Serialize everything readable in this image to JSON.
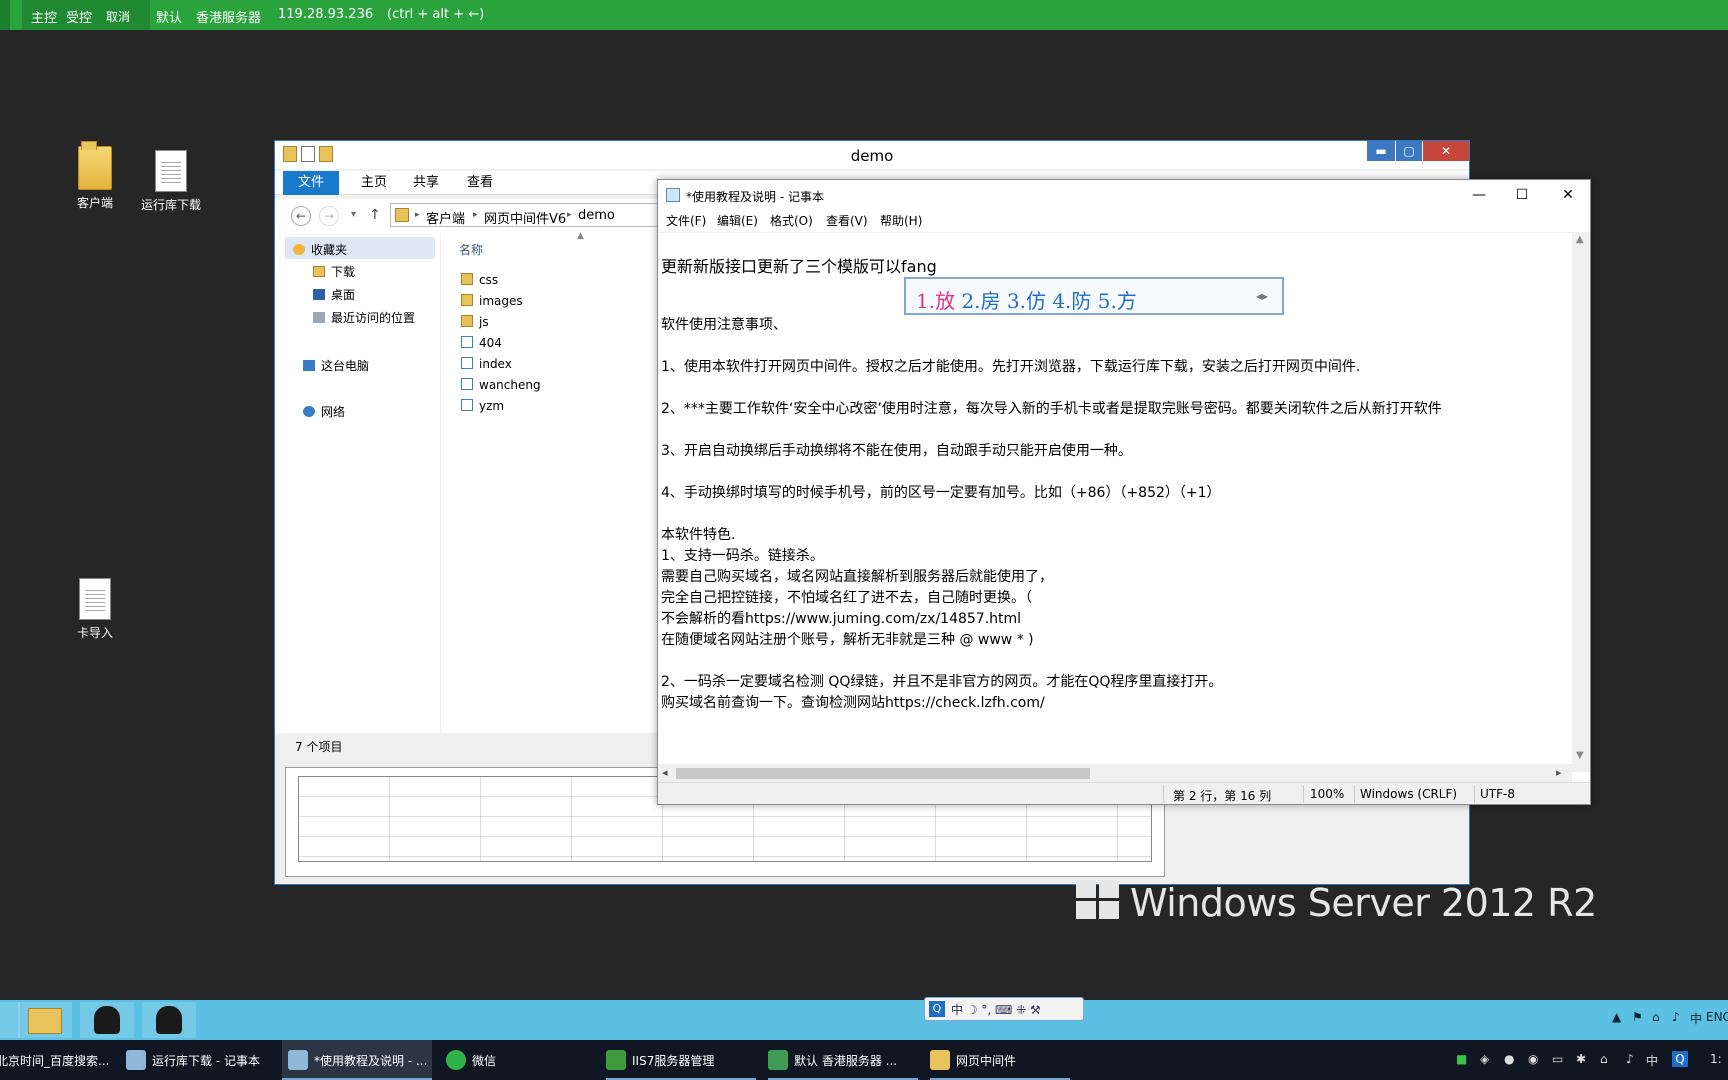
{
  "remote_bar": {
    "items": [
      "主控",
      "受控",
      "取消"
    ],
    "profile": "默认",
    "server_name": "香港服务器",
    "ip": "119.28.93.236",
    "hint": "(ctrl + alt + ←)"
  },
  "desktop": {
    "icons": [
      {
        "label": "客户端",
        "type": "folder"
      },
      {
        "label": "运行库下载",
        "type": "file"
      },
      {
        "label": "卡导入",
        "type": "file"
      }
    ]
  },
  "explorer": {
    "title": "demo",
    "controls": {
      "minimize": "▬",
      "maximize": "▢",
      "close": "✕"
    },
    "ribbon_tabs": [
      "文件",
      "主页",
      "共享",
      "查看"
    ],
    "nav_back": "←",
    "nav_forward": "→",
    "nav_up": "↑",
    "breadcrumb": [
      "客户端",
      "网页中间件V6",
      "demo"
    ],
    "nav": {
      "favorites": "收藏夹",
      "downloads": "下载",
      "desktop": "桌面",
      "recent": "最近访问的位置",
      "this_pc": "这台电脑",
      "network": "网络"
    },
    "column_name": "名称",
    "files": [
      {
        "name": "css",
        "type": "folder"
      },
      {
        "name": "images",
        "type": "folder"
      },
      {
        "name": "js",
        "type": "folder"
      },
      {
        "name": "404",
        "type": "html"
      },
      {
        "name": "index",
        "type": "html"
      },
      {
        "name": "wancheng",
        "type": "html"
      },
      {
        "name": "yzm",
        "type": "html"
      }
    ],
    "status": "7 个项目"
  },
  "notepad": {
    "title": "*使用教程及说明 - 记事本",
    "controls": {
      "minimize": "—",
      "maximize": "☐",
      "close": "✕"
    },
    "menu": [
      "文件(F)",
      "编辑(E)",
      "格式(O)",
      "查看(V)",
      "帮助(H)"
    ],
    "lines": [
      "更新新版接口更新了三个模版可以fang",
      "",
      "软件使用注意事项、",
      "",
      "1、使用本软件打开网页中间件。授权之后才能使用。先打开浏览器，下载运行库下载，安装之后打开网页中间件.",
      "",
      "2、***主要工作软件‘安全中心改密’使用时注意，每次导入新的手机卡或者是提取完账号密码。都要关闭软件之后从新打开软件",
      "",
      "3、开启自动换绑后手动换绑将不能在使用，自动跟手动只能开启使用一种。",
      "",
      "4、手动换绑时填写的时候手机号，前的区号一定要有加号。比如（+86）（+852）（+1）",
      "",
      "本软件特色.",
      "1、支持一码杀。链接杀。",
      "需要自己购买域名，域名网站直接解析到服务器后就能使用了，",
      "完全自己把控链接，不怕域名红了进不去，自己随时更换。（",
      "不会解析的看https://www.juming.com/zx/14857.html",
      "在随便域名网站注册个账号，解析无非就是三种  @ www  * )",
      "",
      "2、一码杀一定要域名检测 QQ绿链，并且不是非官方的网页。才能在QQ程序里直接打开。",
      "购买域名前查询一下。查询检测网站https://check.lzfh.com/"
    ],
    "status": {
      "position": "第 2 行，第 16 列",
      "zoom": "100%",
      "line_ending": "Windows (CRLF)",
      "encoding": "UTF-8"
    }
  },
  "ime": {
    "first": "1.放",
    "rest": "2.房 3.仿 4.防 5.方",
    "pager": "◂▸"
  },
  "watermark": "Windows Server 2012 R2",
  "lang_bar": {
    "logo": "Q",
    "text": "中 ☽ °, ⌨ ⁜ ⚒"
  },
  "inner_tray": {
    "lang": "ENG",
    "ime": "中"
  },
  "host_taskbar": {
    "tasks": [
      {
        "label": "北京时间_百度搜索...",
        "color": "#2b6fd6"
      },
      {
        "label": "运行库下载 - 记事本",
        "color": "#8fb7d8"
      },
      {
        "label": "*使用教程及说明 - ...",
        "color": "#8fb7d8"
      },
      {
        "label": "微信",
        "color": "#2fb24a"
      },
      {
        "label": "IIS7服务器管理",
        "color": "#3d9b3d"
      },
      {
        "label": "默认  香港服务器 ...",
        "color": "#3f9c55"
      },
      {
        "label": "网页中间件",
        "color": "#e8c25a"
      }
    ],
    "tray_text": "中",
    "clock": "1:"
  }
}
